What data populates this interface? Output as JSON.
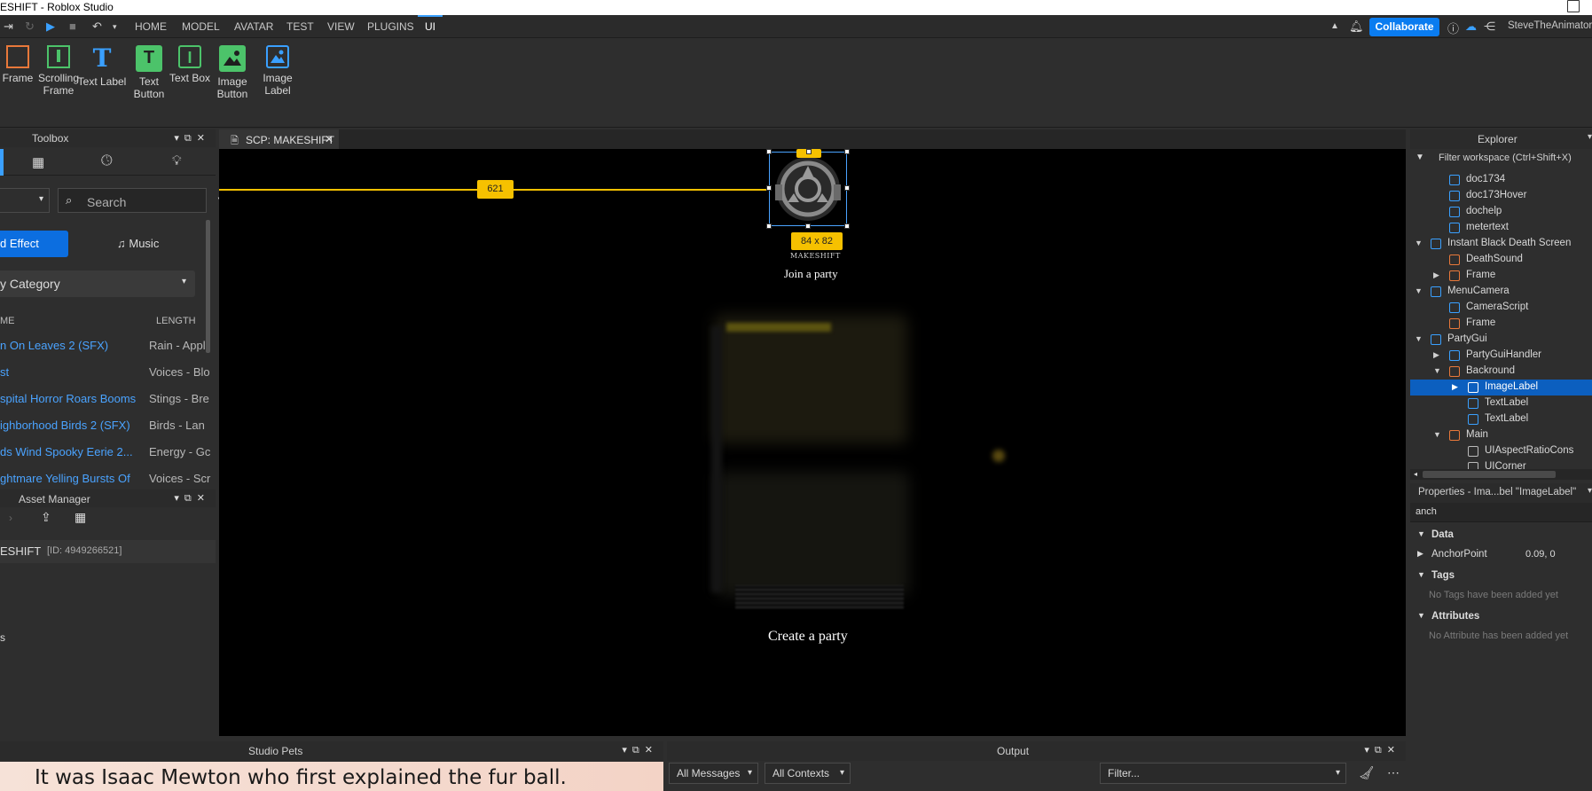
{
  "window": {
    "title": "ESHIFT - Roblox Studio"
  },
  "menu": {
    "tabs": [
      "HOME",
      "MODEL",
      "AVATAR",
      "TEST",
      "VIEW",
      "PLUGINS",
      "UI"
    ],
    "active_tab": "UI",
    "collaborate_label": "Collaborate",
    "username": "SteveTheAnimator"
  },
  "ribbon": {
    "tools": [
      {
        "label": "Frame",
        "icon": "frame-icon",
        "color": "#e8783a"
      },
      {
        "label": "Scrolling Frame",
        "icon": "scrolling-frame-icon",
        "color": "#4cc36a"
      },
      {
        "label": "Text Label",
        "icon": "text-label-icon",
        "color": "#3aa0ff"
      },
      {
        "label": "Text Button",
        "icon": "text-button-icon",
        "color": "#4cc36a"
      },
      {
        "label": "Text Box",
        "icon": "text-box-icon",
        "color": "#4cc36a"
      },
      {
        "label": "Image Button",
        "icon": "image-button-icon",
        "color": "#4cc36a"
      },
      {
        "label": "Image Label",
        "icon": "image-label-icon",
        "color": "#3aa0ff"
      }
    ]
  },
  "toolbox": {
    "title": "Toolbox",
    "search_placeholder": "Search",
    "tab_active": "d Effect",
    "tab_music": "Music",
    "category": "y Category",
    "col_name": "ME",
    "col_length": "LENGTH",
    "rows": [
      {
        "name": "n On Leaves 2 (SFX)",
        "length": "Rain - Appl"
      },
      {
        "name": "st",
        "length": "Voices - Blo"
      },
      {
        "name": "spital Horror Roars Booms",
        "length": "Stings - Bre"
      },
      {
        "name": "ighborhood Birds 2 (SFX)",
        "length": "Birds - Lan"
      },
      {
        "name": "ds Wind Spooky Eerie 2...",
        "length": "Energy - Gc"
      },
      {
        "name": "ghtmare Yelling Bursts Of",
        "length": "Voices - Scr"
      }
    ]
  },
  "asset_manager": {
    "title": "Asset Manager",
    "place_name": "ESHIFT",
    "place_id": "[ID: 4949266521]",
    "stray_letter": "s"
  },
  "document": {
    "tab_label": "SCP: MAKESHIFT",
    "distance_badge": "621",
    "size_badge": "84 x 82",
    "logo_caption": "MAKESHIFT",
    "join_label": "Join a party",
    "create_label": "Create a party"
  },
  "explorer": {
    "title": "Explorer",
    "filter_placeholder": "Filter workspace (Ctrl+Shift+X)",
    "items": [
      {
        "label": "doc1734",
        "indent": 4,
        "icon": "image-button-icon",
        "color": "#3aa0ff",
        "arrow": ""
      },
      {
        "label": "doc173Hover",
        "indent": 4,
        "icon": "text-label-icon",
        "color": "#3aa0ff",
        "arrow": ""
      },
      {
        "label": "dochelp",
        "indent": 4,
        "icon": "text-label-icon",
        "color": "#3aa0ff",
        "arrow": ""
      },
      {
        "label": "metertext",
        "indent": 4,
        "icon": "text-label-icon",
        "color": "#3aa0ff",
        "arrow": ""
      },
      {
        "label": "Instant Black Death Screen",
        "indent": 3,
        "icon": "screen-gui-icon",
        "color": "#3aa0ff",
        "arrow": "down"
      },
      {
        "label": "DeathSound",
        "indent": 4,
        "icon": "sound-icon",
        "color": "#e8783a",
        "arrow": ""
      },
      {
        "label": "Frame",
        "indent": 4,
        "icon": "frame-icon",
        "color": "#e8783a",
        "arrow": "right"
      },
      {
        "label": "MenuCamera",
        "indent": 3,
        "icon": "screen-gui-icon",
        "color": "#3aa0ff",
        "arrow": "down"
      },
      {
        "label": "CameraScript",
        "indent": 4,
        "icon": "local-script-icon",
        "color": "#3aa0ff",
        "arrow": ""
      },
      {
        "label": "Frame",
        "indent": 4,
        "icon": "frame-icon",
        "color": "#e8783a",
        "arrow": ""
      },
      {
        "label": "PartyGui",
        "indent": 3,
        "icon": "screen-gui-icon",
        "color": "#3aa0ff",
        "arrow": "down"
      },
      {
        "label": "PartyGuiHandler",
        "indent": 4,
        "icon": "local-script-icon",
        "color": "#3aa0ff",
        "arrow": "right"
      },
      {
        "label": "Backround",
        "indent": 4,
        "icon": "frame-icon",
        "color": "#e8783a",
        "arrow": "down"
      },
      {
        "label": "ImageLabel",
        "indent": 5,
        "icon": "image-label-icon",
        "color": "#ffffff",
        "arrow": "right",
        "selected": true
      },
      {
        "label": "TextLabel",
        "indent": 5,
        "icon": "text-label-icon",
        "color": "#3aa0ff",
        "arrow": ""
      },
      {
        "label": "TextLabel",
        "indent": 5,
        "icon": "text-label-icon",
        "color": "#3aa0ff",
        "arrow": ""
      },
      {
        "label": "Main",
        "indent": 4,
        "icon": "frame-icon",
        "color": "#e8783a",
        "arrow": "down"
      },
      {
        "label": "UIAspectRatioCons",
        "indent": 5,
        "icon": "aspect-ratio-icon",
        "color": "#bbbbbb",
        "arrow": ""
      },
      {
        "label": "UICorner",
        "indent": 5,
        "icon": "corner-icon",
        "color": "#bbbbbb",
        "arrow": ""
      }
    ]
  },
  "properties": {
    "title": "Properties - Ima...bel \"ImageLabel\"",
    "filter_value": "anch",
    "section_data": "Data",
    "prop_name": "AnchorPoint",
    "prop_value": "0.09, 0",
    "section_tags": "Tags",
    "tags_empty": "No Tags have been added yet",
    "section_attributes": "Attributes",
    "attributes_empty": "No Attribute has been added yet"
  },
  "studio_pets": {
    "title": "Studio Pets",
    "fact": "It was Isaac Mewton who first explained the fur ball."
  },
  "output": {
    "title": "Output",
    "messages_filter": "All Messages",
    "contexts_filter": "All Contexts",
    "filter_placeholder": "Filter..."
  }
}
